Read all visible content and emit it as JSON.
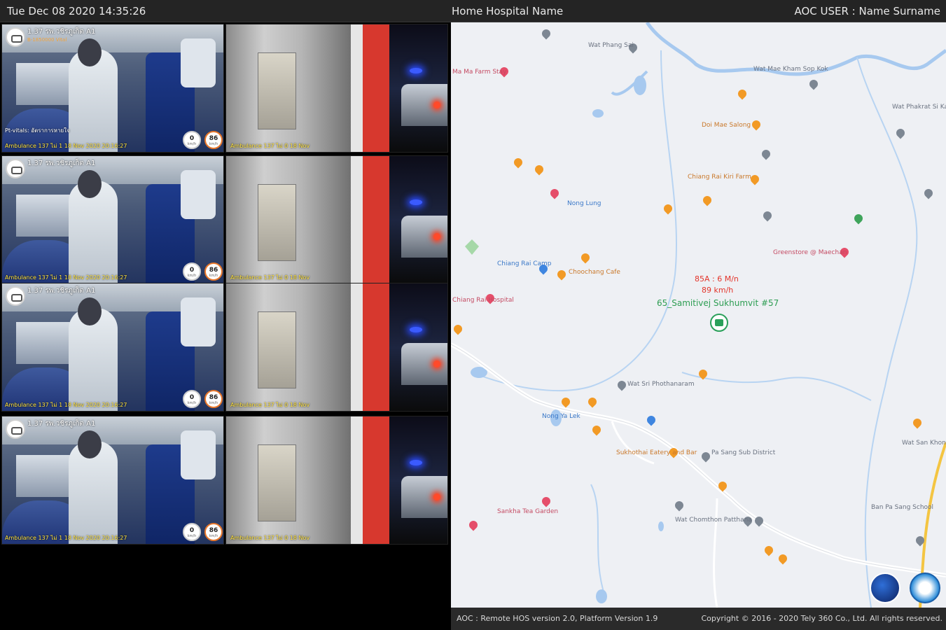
{
  "header": {
    "datetime": "Tue Dec 08 2020 14:35:26",
    "hospital": "Home Hospital Name",
    "user": "AOC USER : Name Surname"
  },
  "cameras": [
    {
      "title": "1.37 รพ.วชิรภูเก็ต A1",
      "subtitle": "B-1850000 Vital",
      "caption": "Pt-vitals: อัตราการหายใจ",
      "stamp": "Ambulance 137 ไม่ 1 18 Nov 2020 20:16:27",
      "outer_stamp": "Ambulance 137 ไม่ 0 18 Nov",
      "badge1": {
        "value": "0",
        "unit": "km/h"
      },
      "badge2": {
        "value": "86",
        "unit": "km/h"
      }
    },
    {
      "title": "1.37 รพ.วชิรภูเก็ต A1",
      "subtitle": "",
      "caption": "",
      "stamp": "Ambulance 137 ไม่ 1 18 Nov 2020 20:16:27",
      "outer_stamp": "Ambulance 137 ไม่ 0 18 Nov",
      "badge1": {
        "value": "0",
        "unit": "km/h"
      },
      "badge2": {
        "value": "86",
        "unit": "km/h"
      }
    },
    {
      "title": "1.37 รพ.วชิรภูเก็ต A1",
      "subtitle": "",
      "caption": "",
      "stamp": "Ambulance 137 ไม่ 1 18 Nov 2020 20:16:27",
      "outer_stamp": "Ambulance 137 ไม่ 0 18 Nov",
      "badge1": {
        "value": "0",
        "unit": "km/h"
      },
      "badge2": {
        "value": "86",
        "unit": "km/h"
      }
    },
    {
      "title": "1.37 รพ.วชิรภูเก็ต A1",
      "subtitle": "",
      "caption": "",
      "stamp": "Ambulance 137 ไม่ 1 18 Nov 2020 20:16:27",
      "outer_stamp": "Ambulance 137 ไม่ 0 18 Nov",
      "badge1": {
        "value": "0",
        "unit": "km/h"
      },
      "badge2": {
        "value": "86",
        "unit": "km/h"
      }
    }
  ],
  "map": {
    "vehicle": {
      "info1": "85A : 6 M/n",
      "info2": "89 km/h",
      "name": "65_Samitivej Sukhumvit #57"
    },
    "places": [
      {
        "name": "Wat Phang Sai",
        "color": "grey"
      },
      {
        "name": "Wat Mae Kham Sop Kok",
        "color": "grey"
      },
      {
        "name": "Ma Ma Farm Stay",
        "color": "pink"
      },
      {
        "name": "Wat Phakrat Si Kam",
        "color": "grey"
      },
      {
        "name": "Doi Mae Salong",
        "color": "orange"
      },
      {
        "name": "Chiang Rai Kiri Farm",
        "color": "orange"
      },
      {
        "name": "Nong Lung",
        "color": "blue"
      },
      {
        "name": "Greenstore @ Maechan",
        "color": "pink"
      },
      {
        "name": "Chiang Rai Camp",
        "color": "orange"
      },
      {
        "name": "Choochang Cafe",
        "color": "orange"
      },
      {
        "name": "Chiang Rai Hospital",
        "color": "pink"
      },
      {
        "name": "Wat Sri Phothanaram",
        "color": "grey"
      },
      {
        "name": "Nong Ya Lek",
        "color": "blue"
      },
      {
        "name": "Sukhothai Eatery and Bar",
        "color": "orange"
      },
      {
        "name": "Pa Sang Sub District",
        "color": "grey"
      },
      {
        "name": "Sankha Tea Garden",
        "color": "pink"
      },
      {
        "name": "Wat Chomthon Patthana",
        "color": "grey"
      },
      {
        "name": "Ban Pa Sang School",
        "color": "grey"
      },
      {
        "name": "Wat San Khong",
        "color": "grey"
      }
    ]
  },
  "footer": {
    "version": "AOC : Remote HOS version 2.0, Platform Version 1.9",
    "copyright": "Copyright © 2016 - 2020 Tely 360 Co., Ltd. All rights reserved."
  }
}
